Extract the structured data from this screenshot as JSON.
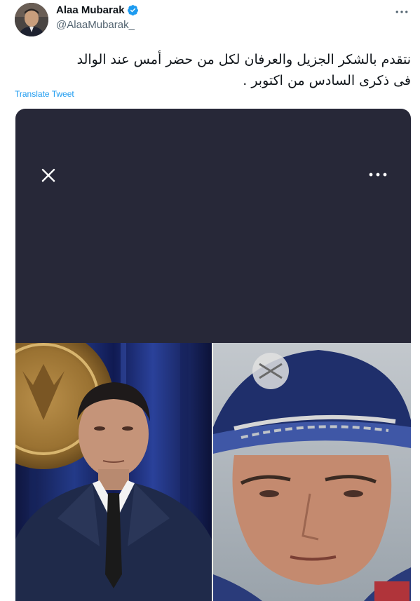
{
  "author": {
    "display_name": "Alaa Mubarak",
    "handle": "@AlaaMubarak_",
    "verified_icon": "verified-badge-icon",
    "avatar_icon": "profile-photo"
  },
  "tweet": {
    "text_line1": "نتقدم بالشكر الجزيل والعرفان لكل من حضر أمس عند الوالد",
    "text_line2": "فى ذكرى السادس من اكتوبر .",
    "translate_label": "Translate Tweet"
  },
  "icons": {
    "more": "more-horizontal-icon",
    "close": "close-icon",
    "media_more": "more-horizontal-icon"
  },
  "colors": {
    "link": "#1d9bf0",
    "verified": "#1d9bf0",
    "media_background": "#272838",
    "handle": "#536471"
  }
}
